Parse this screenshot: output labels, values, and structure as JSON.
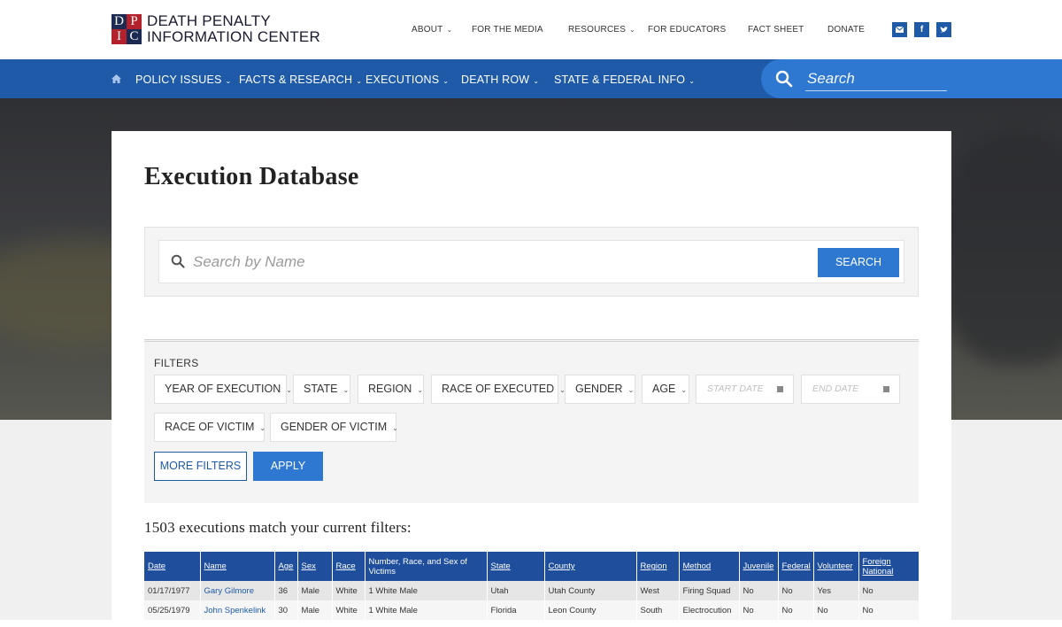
{
  "brand": {
    "logo_letters": [
      "D",
      "P",
      "I",
      "C"
    ],
    "line1": "DEATH PENALTY",
    "line2": "INFORMATION CENTER",
    "colors": {
      "red": "#b3222c",
      "navy": "#1b2a52",
      "primary": "#1e5aa8"
    }
  },
  "topnav": [
    {
      "label": "ABOUT",
      "dropdown": true
    },
    {
      "label": "FOR THE MEDIA",
      "dropdown": false
    },
    {
      "label": "RESOURCES",
      "dropdown": true
    },
    {
      "label": "FOR EDUCATORS",
      "dropdown": false
    },
    {
      "label": "FACT SHEET",
      "dropdown": false
    },
    {
      "label": "DONATE",
      "dropdown": false
    }
  ],
  "social": [
    "envelope-icon",
    "facebook-icon",
    "twitter-icon"
  ],
  "mainnav": {
    "home_icon": "home-icon",
    "items": [
      "POLICY ISSUES",
      "FACTS & RESEARCH",
      "EXECUTIONS",
      "DEATH ROW",
      "STATE & FEDERAL INFO"
    ],
    "search_placeholder": "Search"
  },
  "page": {
    "title": "Execution Database",
    "search_placeholder": "Search by Name",
    "search_button": "SEARCH"
  },
  "filters": {
    "label": "FILTERS",
    "row1": [
      "YEAR OF EXECUTION",
      "STATE",
      "REGION",
      "RACE OF EXECUTED",
      "GENDER",
      "AGE"
    ],
    "start_date_placeholder": "START DATE",
    "end_date_placeholder": "END DATE",
    "row2": [
      "RACE OF VICTIM",
      "GENDER OF VICTIM"
    ],
    "more_filters": "MORE FILTERS",
    "apply": "APPLY"
  },
  "results": {
    "count_text": "1503 executions match your current filters:"
  },
  "table": {
    "headers": [
      "Date",
      "Name",
      "Age",
      "Sex",
      "Race",
      "Number, Race, and Sex of Victims",
      "State",
      "County",
      "Region",
      "Method",
      "Juvenile",
      "Federal",
      "Volunteer",
      "Foreign National"
    ],
    "rows": [
      [
        "01/17/1977",
        "Gary Gilmore",
        "36",
        "Male",
        "White",
        "1 White Male",
        "Utah",
        "Utah County",
        "West",
        "Firing Squad",
        "No",
        "No",
        "Yes",
        "No"
      ],
      [
        "05/25/1979",
        "John Spenkelink",
        "30",
        "Male",
        "White",
        "1 White Male",
        "Florida",
        "Leon County",
        "South",
        "Electrocution",
        "No",
        "No",
        "No",
        "No"
      ]
    ]
  }
}
